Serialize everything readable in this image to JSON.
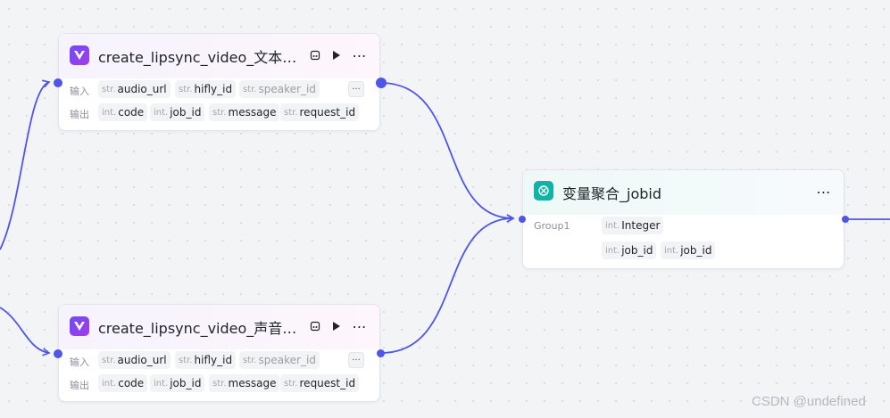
{
  "colors": {
    "edge": "#4f55e6",
    "plugin_icon": "#7c4df0",
    "agg_icon": "#10b3a4"
  },
  "nodes": {
    "text_node": {
      "title": "create_lipsync_video_文本…",
      "input_label": "输入",
      "output_label": "输出",
      "inputs": [
        {
          "type": "str.",
          "name": "audio_url"
        },
        {
          "type": "str.",
          "name": "hifly_id"
        },
        {
          "type": "str.",
          "name": "speaker_id"
        }
      ],
      "outputs": [
        {
          "type": "int.",
          "name": "code"
        },
        {
          "type": "int.",
          "name": "job_id"
        },
        {
          "type": "str.",
          "name": "message"
        },
        {
          "type": "str.",
          "name": "request_id"
        }
      ],
      "more": "···"
    },
    "audio_node": {
      "title": "create_lipsync_video_声音…",
      "input_label": "输入",
      "output_label": "输出",
      "inputs": [
        {
          "type": "str.",
          "name": "audio_url"
        },
        {
          "type": "str.",
          "name": "hifly_id"
        },
        {
          "type": "str.",
          "name": "speaker_id"
        }
      ],
      "outputs": [
        {
          "type": "int.",
          "name": "code"
        },
        {
          "type": "int.",
          "name": "job_id"
        },
        {
          "type": "str.",
          "name": "message"
        },
        {
          "type": "str.",
          "name": "request_id"
        }
      ],
      "more": "···"
    },
    "agg_node": {
      "title": "变量聚合_jobid",
      "group_label": "Group1",
      "group_type": {
        "type": "int.",
        "name": "Integer"
      },
      "vars": [
        {
          "type": "int.",
          "name": "job_id"
        },
        {
          "type": "int.",
          "name": "job_id"
        }
      ]
    }
  },
  "header_icons": [
    "snapshot-icon",
    "play-icon",
    "more-icon"
  ],
  "watermark": "CSDN @undefined"
}
